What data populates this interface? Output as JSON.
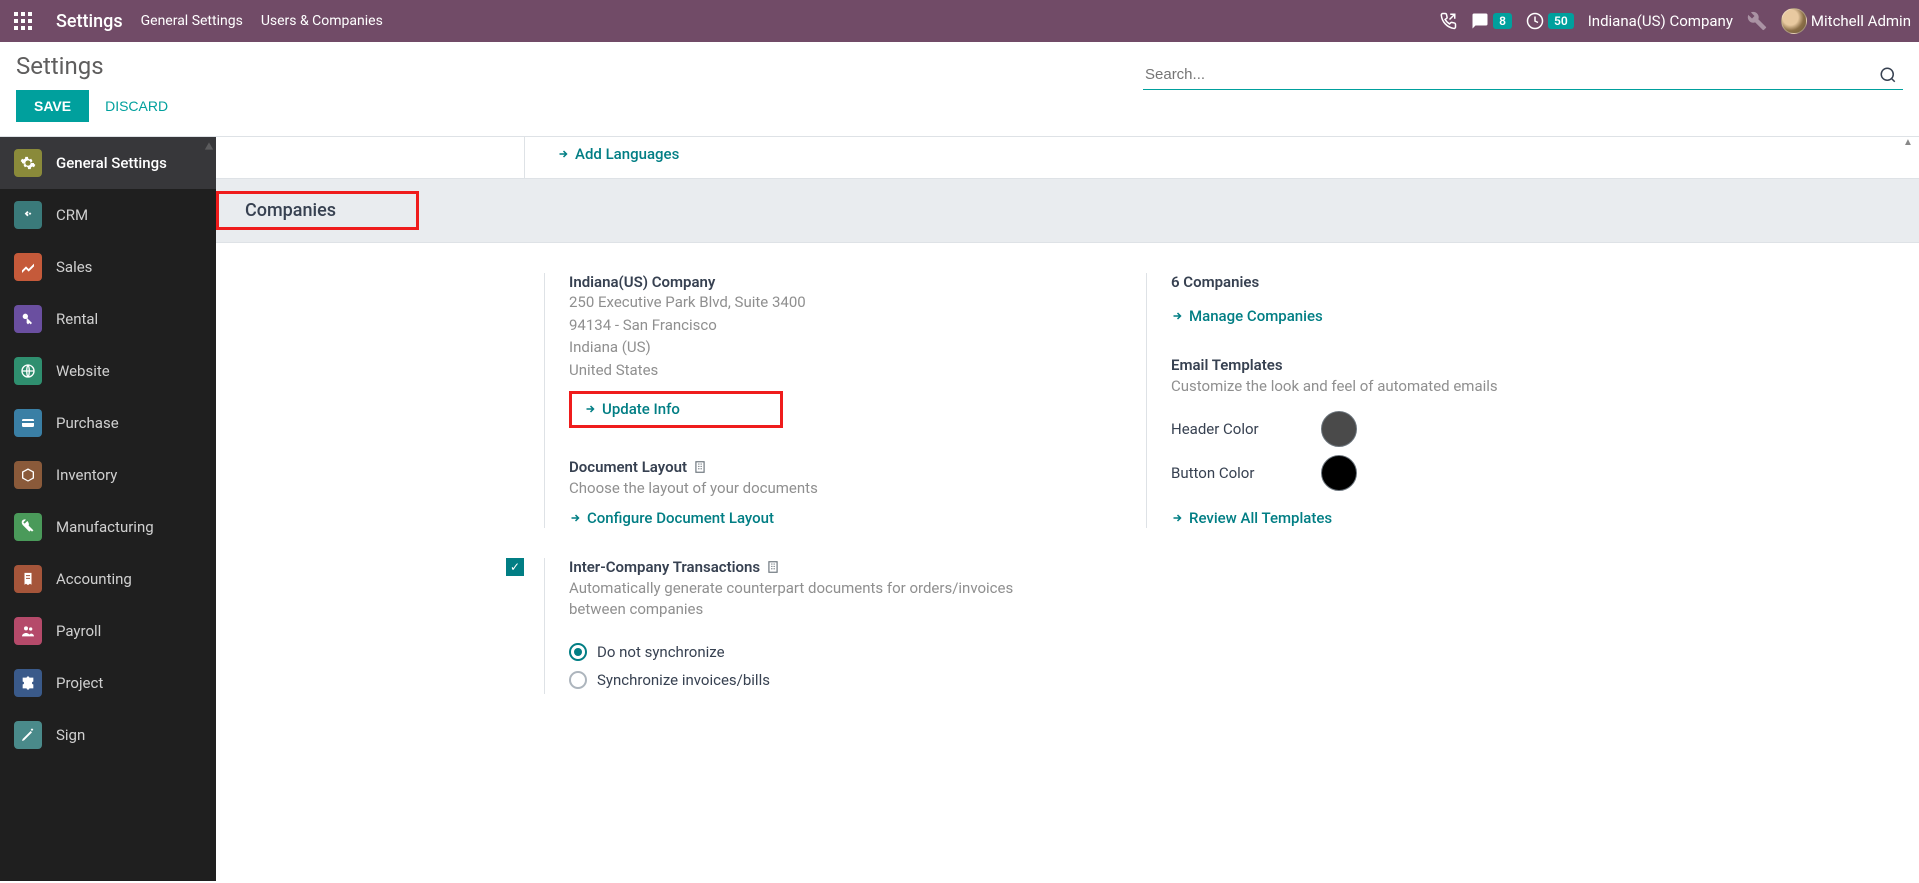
{
  "navbar": {
    "brand": "Settings",
    "menu": [
      "General Settings",
      "Users & Companies"
    ],
    "msg_count": "8",
    "clock_count": "50",
    "company": "Indiana(US) Company",
    "user": "Mitchell Admin"
  },
  "control": {
    "title": "Settings",
    "save": "SAVE",
    "discard": "DISCARD",
    "search_placeholder": "Search..."
  },
  "sidebar": {
    "items": [
      {
        "label": "General Settings",
        "color": "#8a8a3a"
      },
      {
        "label": "CRM",
        "color": "#3a7a7a"
      },
      {
        "label": "Sales",
        "color": "#c55a3a"
      },
      {
        "label": "Rental",
        "color": "#6a4fa0"
      },
      {
        "label": "Website",
        "color": "#2f8f6f"
      },
      {
        "label": "Purchase",
        "color": "#3a7fa5"
      },
      {
        "label": "Inventory",
        "color": "#8a5a3a"
      },
      {
        "label": "Manufacturing",
        "color": "#4a9a5a"
      },
      {
        "label": "Accounting",
        "color": "#a5553a"
      },
      {
        "label": "Payroll",
        "color": "#b54a6a"
      },
      {
        "label": "Project",
        "color": "#3a5a8a"
      },
      {
        "label": "Sign",
        "color": "#4a8a8a"
      }
    ]
  },
  "content": {
    "add_languages": "Add Languages",
    "section_companies": "Companies",
    "company_name": "Indiana(US) Company",
    "company_addr1": "250 Executive Park Blvd, Suite 3400",
    "company_addr2": "94134 - San Francisco",
    "company_state": "Indiana (US)",
    "company_country": "United States",
    "update_info": "Update Info",
    "doc_layout_title": "Document Layout",
    "doc_layout_desc": "Choose the layout of your documents",
    "configure_layout": "Configure Document Layout",
    "intercompany_title": "Inter-Company Transactions",
    "intercompany_desc": "Automatically generate counterpart documents for orders/invoices between companies",
    "radio_opts": [
      "Do not synchronize",
      "Synchronize invoices/bills"
    ],
    "companies_count": "6 Companies",
    "manage_companies": "Manage Companies",
    "email_templates_title": "Email Templates",
    "email_templates_desc": "Customize the look and feel of automated emails",
    "header_color_label": "Header Color",
    "button_color_label": "Button Color",
    "header_color": "#4a4a4a",
    "button_color": "#000000",
    "review_templates": "Review All Templates"
  }
}
